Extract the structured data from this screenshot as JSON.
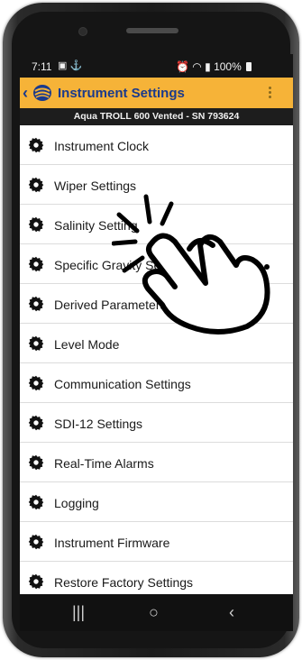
{
  "status_bar": {
    "time": "7:11",
    "battery": "100%"
  },
  "app_bar": {
    "title": "Instrument Settings",
    "back_icon": "chevron-left-icon",
    "menu_icon": "more-vertical-icon",
    "color": "#f6b338",
    "title_color": "#1a3a8c"
  },
  "device": {
    "subtitle": "Aqua TROLL 600 Vented - SN 793624"
  },
  "settings": {
    "items": [
      {
        "label": "Instrument Clock"
      },
      {
        "label": "Wiper Settings"
      },
      {
        "label": "Salinity Setting"
      },
      {
        "label": "Specific Gravity Setti"
      },
      {
        "label": "Derived Parameters"
      },
      {
        "label": "Level Mode"
      },
      {
        "label": "Communication Settings"
      },
      {
        "label": "SDI-12 Settings"
      },
      {
        "label": "Real-Time Alarms"
      },
      {
        "label": "Logging"
      },
      {
        "label": "Instrument Firmware"
      },
      {
        "label": "Restore Factory Settings"
      }
    ],
    "item_icon": "gear-icon"
  },
  "nav_bar": {
    "recent": "|||",
    "home": "○",
    "back": "‹"
  }
}
